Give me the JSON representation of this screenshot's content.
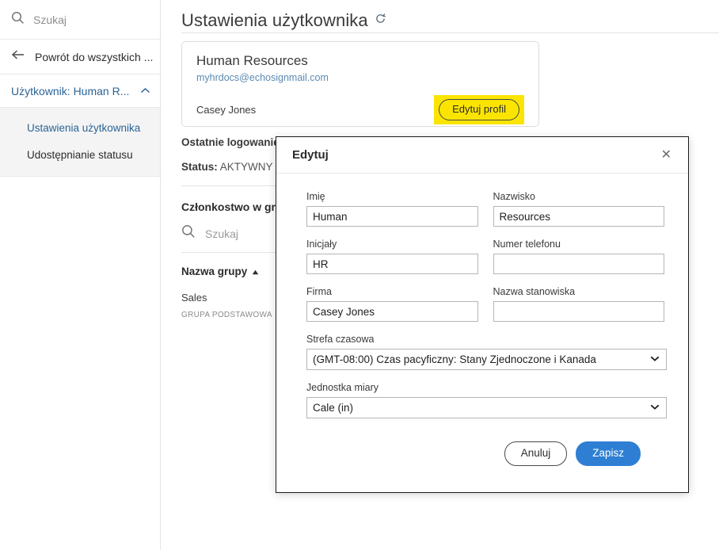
{
  "sidebar": {
    "search": {
      "placeholder": "Szukaj",
      "value": "",
      "icon": "search-icon"
    },
    "back": {
      "label": "Powrót do wszystkich ...",
      "icon": "arrow-left-icon"
    },
    "group": {
      "label": "Użytkownik: Human R...",
      "icon": "chevron-up-icon"
    },
    "submenu": [
      {
        "label": "Ustawienia użytkownika",
        "active": true
      },
      {
        "label": "Udostępnianie statusu",
        "active": false
      }
    ]
  },
  "main": {
    "page_title": "Ustawienia użytkownika",
    "refresh_icon": "refresh-icon",
    "user_card": {
      "name": "Human Resources",
      "email": "myhrdocs@echosignmail.com",
      "person": "Casey Jones",
      "edit_button": "Edytuj profil",
      "highlight_color": "#fbe500"
    },
    "details": {
      "last_login_label": "Ostatnie logowanie:",
      "last_login_value": "",
      "status_label": "Status:",
      "status_value": "AKTYWNY"
    },
    "groups": {
      "section_title": "Członkostwo w gr",
      "search_placeholder": "Szukaj",
      "search_value": "",
      "search_icon": "search-icon",
      "column_header": "Nazwa grupy",
      "sort_icon": "sort-asc-icon",
      "rows": [
        {
          "name": "Sales",
          "badge": "GRUPA PODSTAWOWA"
        }
      ]
    }
  },
  "modal": {
    "title": "Edytuj",
    "close_icon": "close-icon",
    "fields": {
      "first_name": {
        "label": "Imię",
        "value": "Human",
        "placeholder": ""
      },
      "last_name": {
        "label": "Nazwisko",
        "value": "Resources",
        "placeholder": ""
      },
      "initials": {
        "label": "Inicjały",
        "value": "HR",
        "placeholder": ""
      },
      "phone": {
        "label": "Numer telefonu",
        "value": "",
        "placeholder": ""
      },
      "company": {
        "label": "Firma",
        "value": "Casey Jones",
        "placeholder": ""
      },
      "job_title": {
        "label": "Nazwa stanowiska",
        "value": "",
        "placeholder": ""
      },
      "timezone": {
        "label": "Strefa czasowa",
        "value": "(GMT-08:00) Czas pacyficzny: Stany Zjednoczone i Kanada",
        "arrow_icon": "chevron-down-icon"
      },
      "unit_of_measure": {
        "label": "Jednostka miary",
        "value": "Cale (in)",
        "arrow_icon": "chevron-down-icon"
      }
    },
    "buttons": {
      "cancel": "Anuluj",
      "save": "Zapisz",
      "save_color": "#2e7fd4"
    }
  }
}
